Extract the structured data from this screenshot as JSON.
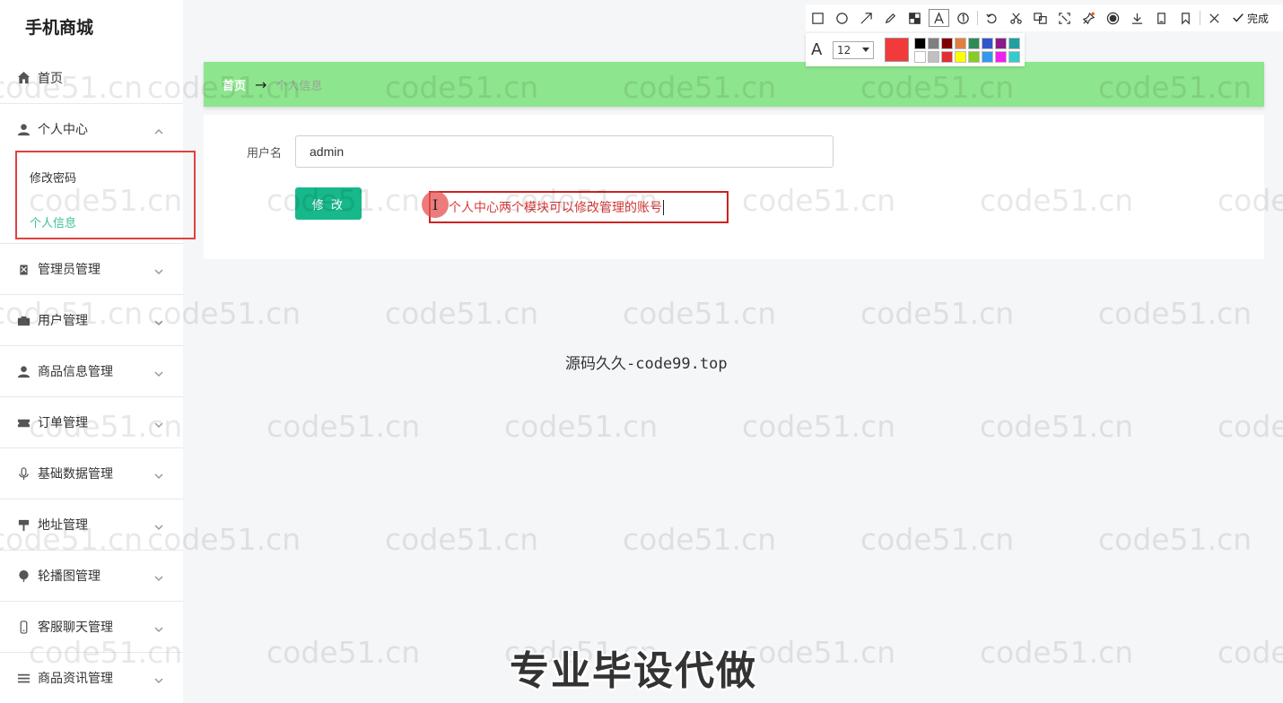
{
  "app": {
    "title": "手机商城"
  },
  "sidebar": {
    "items": [
      {
        "label": "首页",
        "icon": "home-icon"
      },
      {
        "label": "个人中心",
        "icon": "user-icon",
        "expanded": true
      },
      {
        "label": "管理员管理",
        "icon": "clipboard-icon"
      },
      {
        "label": "用户管理",
        "icon": "briefcase-icon"
      },
      {
        "label": "商品信息管理",
        "icon": "user-icon"
      },
      {
        "label": "订单管理",
        "icon": "ticket-icon"
      },
      {
        "label": "基础数据管理",
        "icon": "microphone-icon"
      },
      {
        "label": "地址管理",
        "icon": "signpost-icon"
      },
      {
        "label": "轮播图管理",
        "icon": "balloon-icon"
      },
      {
        "label": "客服聊天管理",
        "icon": "phone-icon"
      },
      {
        "label": "商品资讯管理",
        "icon": "list-icon"
      }
    ],
    "submenu": [
      {
        "label": "修改密码",
        "active": false
      },
      {
        "label": "个人信息",
        "active": true
      }
    ]
  },
  "breadcrumb": {
    "home": "首页",
    "separator": "→",
    "current": "个人信息"
  },
  "form": {
    "username_label": "用户名",
    "username_value": "admin",
    "submit_label": "修 改"
  },
  "annotation": {
    "text": "个人中心两个模块可以修改管理的账号"
  },
  "captions": {
    "center": "源码久久-code99.top",
    "bottom": "专业毕设代做"
  },
  "watermark": {
    "text": "code51.cn"
  },
  "toolbar": {
    "tools": [
      "rectangle-icon",
      "circle-icon",
      "arrow-icon",
      "pencil-icon",
      "mosaic-icon",
      "text-icon",
      "number-icon",
      "undo-icon",
      "cut-icon",
      "translate-icon",
      "crop-icon",
      "pin-icon",
      "record-icon",
      "download-icon",
      "copy-icon",
      "bookmark-icon",
      "close-icon"
    ],
    "done_label": "完成",
    "font_size": "12",
    "current_color": "#f33a3a",
    "palette": [
      "#000000",
      "#808080",
      "#800000",
      "#e08040",
      "#2e8b57",
      "#3355cc",
      "#8b1a8b",
      "#20a0a0",
      "#ffffff",
      "#c0c0c0",
      "#e03030",
      "#ffff00",
      "#88cc22",
      "#3399ee",
      "#ee22ee",
      "#33cccc"
    ]
  },
  "colors": {
    "accent": "#17b88a",
    "breadcrumb_bg": "#8de58d",
    "highlight": "#e04040",
    "active_sub": "#3cc296"
  }
}
